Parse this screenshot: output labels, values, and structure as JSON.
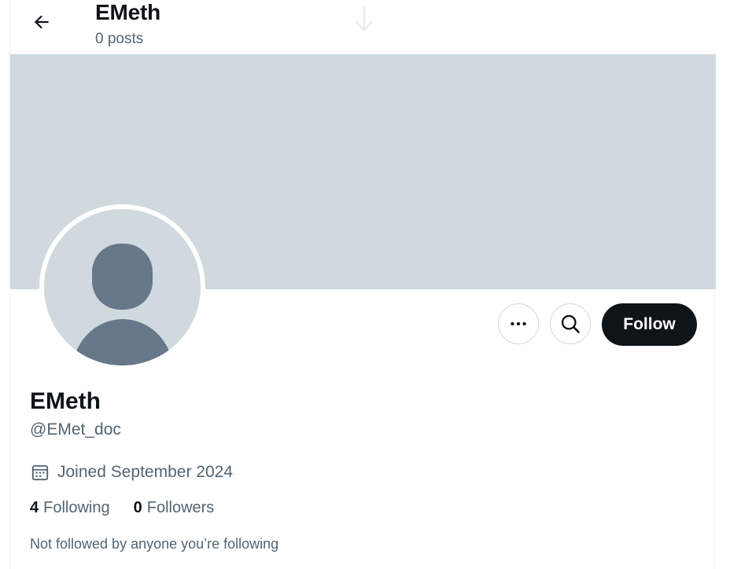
{
  "header": {
    "title": "EMeth",
    "posts_count": "0 posts"
  },
  "profile": {
    "display_name": "EMeth",
    "handle": "@EMet_doc",
    "joined": "Joined September 2024",
    "following_count": "4",
    "following_label": "Following",
    "followers_count": "0",
    "followers_label": "Followers",
    "mutuals_note": "Not followed by anyone you’re following"
  },
  "actions": {
    "follow_label": "Follow",
    "more_icon": "more-horizontal-icon",
    "search_icon": "search-icon"
  },
  "colors": {
    "banner": "#cfd9de",
    "avatar_bg": "#cfd9de",
    "avatar_silhouette": "#66788a",
    "follow_button_bg": "#0f1419",
    "secondary_text": "#536471"
  }
}
